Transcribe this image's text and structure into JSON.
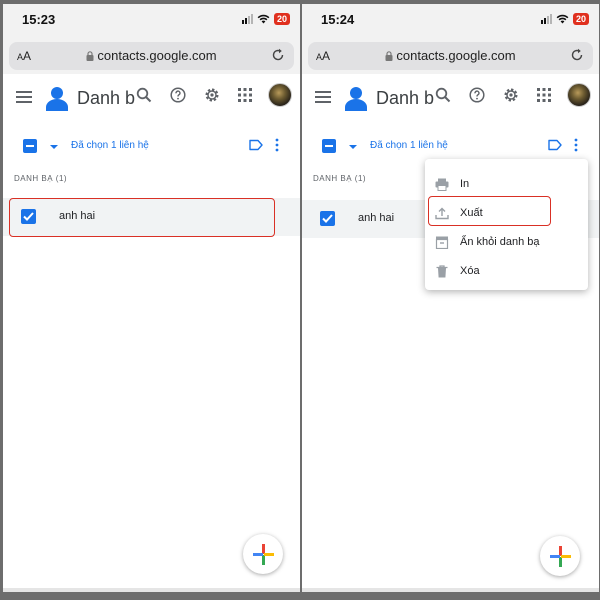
{
  "left": {
    "statusbar": {
      "time": "15:23",
      "battery": "20"
    },
    "browser": {
      "text_size": "AA",
      "url": "contacts.google.com"
    },
    "appbar": {
      "title": "Danh b"
    },
    "selection": {
      "label": "Đã chọn 1 liên hệ"
    },
    "section": {
      "title": "DANH BẠ (1)"
    },
    "contact": {
      "name": "anh hai"
    }
  },
  "right": {
    "statusbar": {
      "time": "15:24",
      "battery": "20"
    },
    "browser": {
      "text_size": "AA",
      "url": "contacts.google.com"
    },
    "appbar": {
      "title": "Danh b"
    },
    "selection": {
      "label": "Đã chọn 1 liên hệ"
    },
    "section": {
      "title": "DANH BẠ (1)"
    },
    "contact": {
      "name": "anh hai"
    },
    "menu": {
      "items": [
        {
          "label": "In",
          "icon": "print-icon"
        },
        {
          "label": "Xuất",
          "icon": "export-icon"
        },
        {
          "label": "Ẩn khỏi danh bạ",
          "icon": "hide-icon"
        },
        {
          "label": "Xóa",
          "icon": "trash-icon"
        }
      ]
    }
  },
  "colors": {
    "accent": "#1a73e8",
    "highlight": "#d93025",
    "battery": "#e0301e"
  }
}
